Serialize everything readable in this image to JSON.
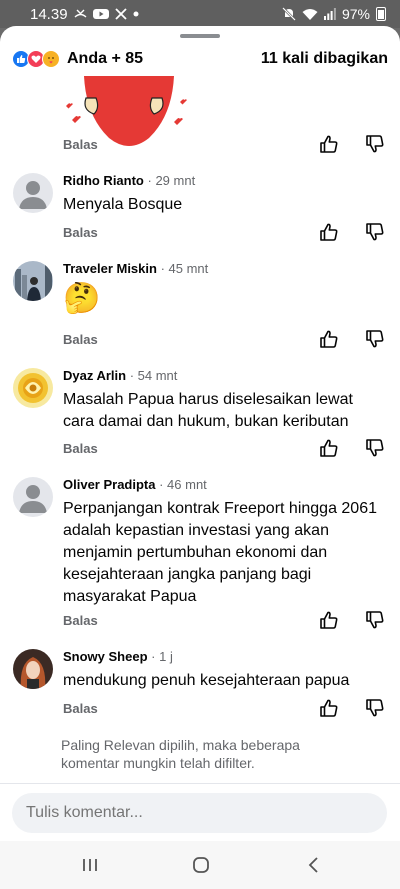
{
  "status": {
    "time": "14.39",
    "battery": "97%",
    "left_icons": [
      "missed-call-icon",
      "youtube-icon",
      "x-icon",
      "dot-icon"
    ],
    "right_icons": [
      "mute-icon",
      "wifi-icon",
      "signal-icon",
      "battery-icon"
    ]
  },
  "header": {
    "reactions": [
      "like",
      "love",
      "care"
    ],
    "reactors": "Anda + 85",
    "shares": "11 kali dibagikan"
  },
  "labels": {
    "reply": "Balas"
  },
  "comments": [
    {
      "name": "Ridho Rianto",
      "time": "· 29 mnt",
      "text": "Menyala Bosque",
      "avatar": "default"
    },
    {
      "name": "Traveler Miskin",
      "time": "· 45 mnt",
      "text": "🤔",
      "avatar": "photo-city"
    },
    {
      "name": "Dyaz Arlin",
      "time": "· 54 mnt",
      "text": "Masalah Papua harus diselesaikan lewat cara damai dan hukum, bukan keributan",
      "avatar": "photo-gold"
    },
    {
      "name": "Oliver Pradipta",
      "time": "· 46 mnt",
      "text": "Perpanjangan kontrak Freeport hingga 2061 adalah kepastian investasi yang akan menjamin pertumbuhan ekonomi dan kesejahteraan jangka panjang bagi masyarakat Papua",
      "avatar": "default"
    },
    {
      "name": "Snowy Sheep",
      "time": "· 1 j",
      "text": "mendukung penuh kesejahteraan papua",
      "avatar": "photo-woman"
    }
  ],
  "footnote": "Paling Relevan dipilih, maka beberapa komentar mungkin telah difilter.",
  "compose": {
    "placeholder": "Tulis komentar..."
  },
  "colors": {
    "like": "#1877f2",
    "love": "#f33e58",
    "secondary_text": "#65676b",
    "compose_bg": "#f0f2f5"
  }
}
